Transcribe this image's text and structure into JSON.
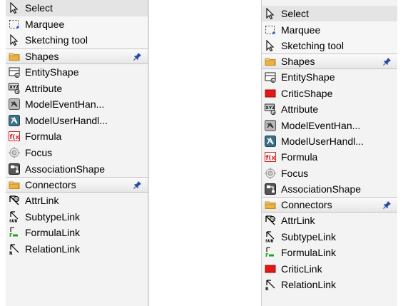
{
  "left_palette": {
    "tools": [
      {
        "label": "Select",
        "icon": "cursor-icon"
      },
      {
        "label": "Marquee",
        "icon": "marquee-icon"
      },
      {
        "label": "Sketching tool",
        "icon": "sketch-cursor-icon"
      }
    ],
    "shapes_header": "Shapes",
    "shapes": [
      {
        "label": "EntityShape",
        "icon": "entity-shape-icon"
      },
      {
        "label": "Attribute",
        "icon": "attribute-icon"
      },
      {
        "label": "ModelEventHan...",
        "icon": "model-event-icon"
      },
      {
        "label": "ModelUserHandl...",
        "icon": "model-user-icon"
      },
      {
        "label": "Formula",
        "icon": "formula-icon"
      },
      {
        "label": "Focus",
        "icon": "focus-icon"
      },
      {
        "label": "AssociationShape",
        "icon": "association-icon"
      }
    ],
    "connectors_header": "Connectors",
    "connectors": [
      {
        "label": "AttrLink",
        "icon": "attr-link-icon"
      },
      {
        "label": "SubtypeLink",
        "icon": "subtype-link-icon"
      },
      {
        "label": "FormulaLink",
        "icon": "formula-link-icon"
      },
      {
        "label": "RelationLink",
        "icon": "relation-link-icon"
      }
    ]
  },
  "right_palette": {
    "tools": [
      {
        "label": "Select",
        "icon": "cursor-icon"
      },
      {
        "label": "Marquee",
        "icon": "marquee-icon"
      },
      {
        "label": "Sketching tool",
        "icon": "sketch-cursor-icon"
      }
    ],
    "shapes_header": "Shapes",
    "shapes": [
      {
        "label": "EntityShape",
        "icon": "entity-shape-icon"
      },
      {
        "label": "CriticShape",
        "icon": "critic-shape-icon"
      },
      {
        "label": "Attribute",
        "icon": "attribute-icon"
      },
      {
        "label": "ModelEventHan...",
        "icon": "model-event-icon"
      },
      {
        "label": "ModelUserHandl...",
        "icon": "model-user-icon"
      },
      {
        "label": "Formula",
        "icon": "formula-icon"
      },
      {
        "label": "Focus",
        "icon": "focus-icon"
      },
      {
        "label": "AssociationShape",
        "icon": "association-icon"
      }
    ],
    "connectors_header": "Connectors",
    "connectors": [
      {
        "label": "AttrLink",
        "icon": "attr-link-icon"
      },
      {
        "label": "SubtypeLink",
        "icon": "subtype-link-icon"
      },
      {
        "label": "FormulaLink",
        "icon": "formula-link-icon"
      },
      {
        "label": "CriticLink",
        "icon": "critic-link-icon"
      },
      {
        "label": "RelationLink",
        "icon": "relation-link-icon"
      }
    ]
  },
  "colors": {
    "critic_red": "#e01818",
    "formula_red": "#d42020",
    "folder_orange": "#f0b040",
    "pin_blue": "#2a4aa8",
    "formula_link_green": "#28a028"
  }
}
